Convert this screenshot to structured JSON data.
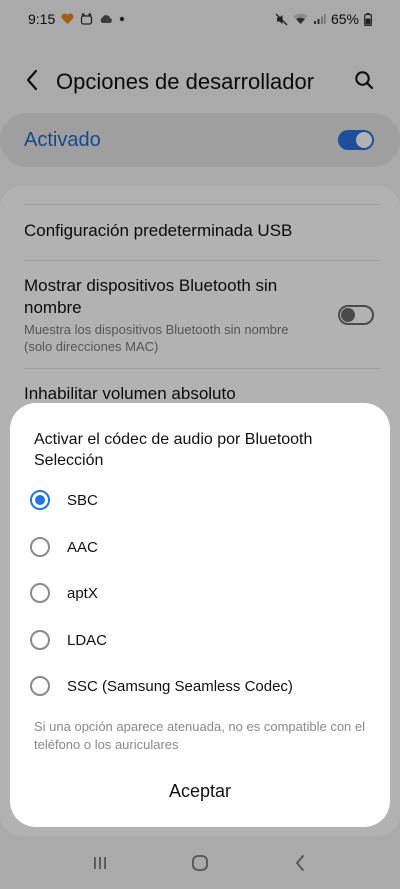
{
  "status_bar": {
    "time": "9:15",
    "battery": "65%"
  },
  "app_bar": {
    "title": "Opciones de desarrollador",
    "back_icon": "back-arrow-icon",
    "search_icon": "search-icon"
  },
  "master_toggle": {
    "label": "Activado",
    "state": "on"
  },
  "settings": {
    "items": [
      {
        "title": "Configuración predeterminada USB"
      },
      {
        "title": "Mostrar dispositivos Bluetooth sin nombre",
        "subtitle": "Muestra los dispositivos Bluetooth sin nombre (solo direcciones MAC)",
        "toggle": "off"
      },
      {
        "title": "Inhabilitar volumen absoluto"
      }
    ]
  },
  "dialog": {
    "title": "Activar el códec de audio por Bluetooth Selección",
    "options": [
      "SBC",
      "AAC",
      "aptX",
      "LDAC",
      "SSC (Samsung Seamless Codec)"
    ],
    "selected": "SBC",
    "note": "Si una opción aparece atenuada, no es compatible con el teléfono o los auriculares",
    "accept_label": "Aceptar"
  },
  "nav_bar": {
    "recents_icon": "recents-icon",
    "home_icon": "home-icon",
    "back_icon": "nav-back-icon"
  },
  "colors": {
    "accent": "#1e74e8",
    "toggle_on": "#2a72e0",
    "active_label": "#1b6ad0"
  }
}
